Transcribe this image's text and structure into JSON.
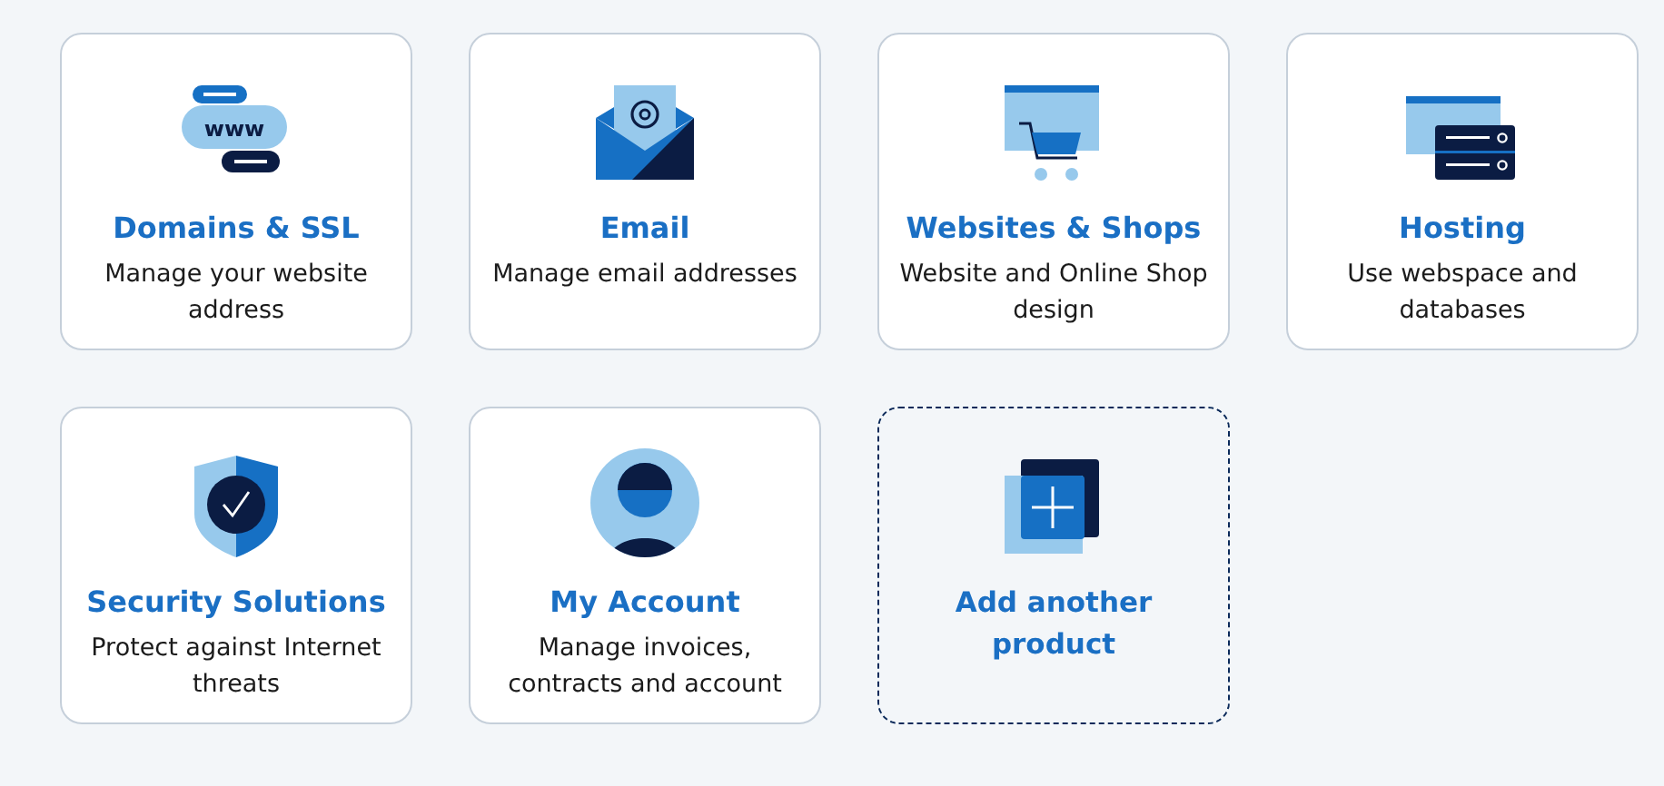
{
  "products": [
    {
      "kind": "domains",
      "icon_text": "www",
      "title": "Domains & SSL",
      "description": "Manage your website address"
    },
    {
      "kind": "email",
      "title": "Email",
      "description": "Manage email addresses"
    },
    {
      "kind": "websites",
      "title": "Websites & Shops",
      "description": "Website and Online Shop design"
    },
    {
      "kind": "hosting",
      "title": "Hosting",
      "description": "Use webspace and databases"
    },
    {
      "kind": "security",
      "title": "Security Solutions",
      "description": "Protect against Internet threats"
    },
    {
      "kind": "account",
      "title": "My Account",
      "description": "Manage invoices, contracts and account"
    },
    {
      "kind": "add",
      "title": "Add another product"
    }
  ]
}
